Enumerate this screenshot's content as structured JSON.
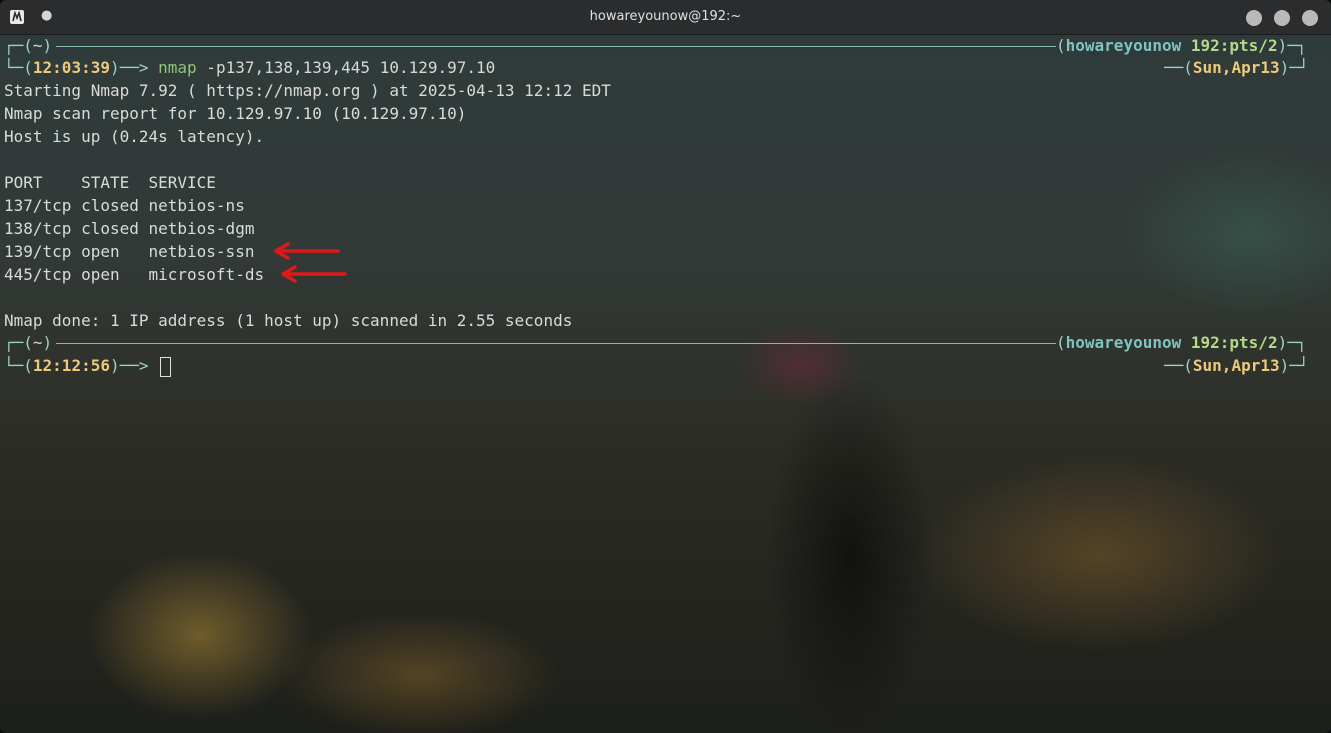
{
  "window": {
    "title": "howareyounow@192:~",
    "pin_glyph": "●"
  },
  "prompt1": {
    "dir": "~",
    "time": "12:03:39",
    "command": "nmap",
    "args": " -p137,138,139,445 10.129.97.10",
    "user": "howareyounow",
    "host": "192:pts/2",
    "date": "Sun,Apr13"
  },
  "output": {
    "line1": "Starting Nmap 7.92 ( https://nmap.org ) at 2025-04-13 12:12 EDT",
    "line2": "Nmap scan report for 10.129.97.10 (10.129.97.10)",
    "line3": "Host is up (0.24s latency).",
    "header": "PORT    STATE  SERVICE",
    "rows": [
      "137/tcp closed netbios-ns",
      "138/tcp closed netbios-dgm",
      "139/tcp open   netbios-ssn",
      "445/tcp open   microsoft-ds"
    ],
    "done": "Nmap done: 1 IP address (1 host up) scanned in 2.55 seconds"
  },
  "prompt2": {
    "dir": "~",
    "time": "12:12:56",
    "user": "howareyounow",
    "host": "192:pts/2",
    "date": "Sun,Apr13"
  },
  "colors": {
    "annotation_arrow": "#e01818"
  }
}
